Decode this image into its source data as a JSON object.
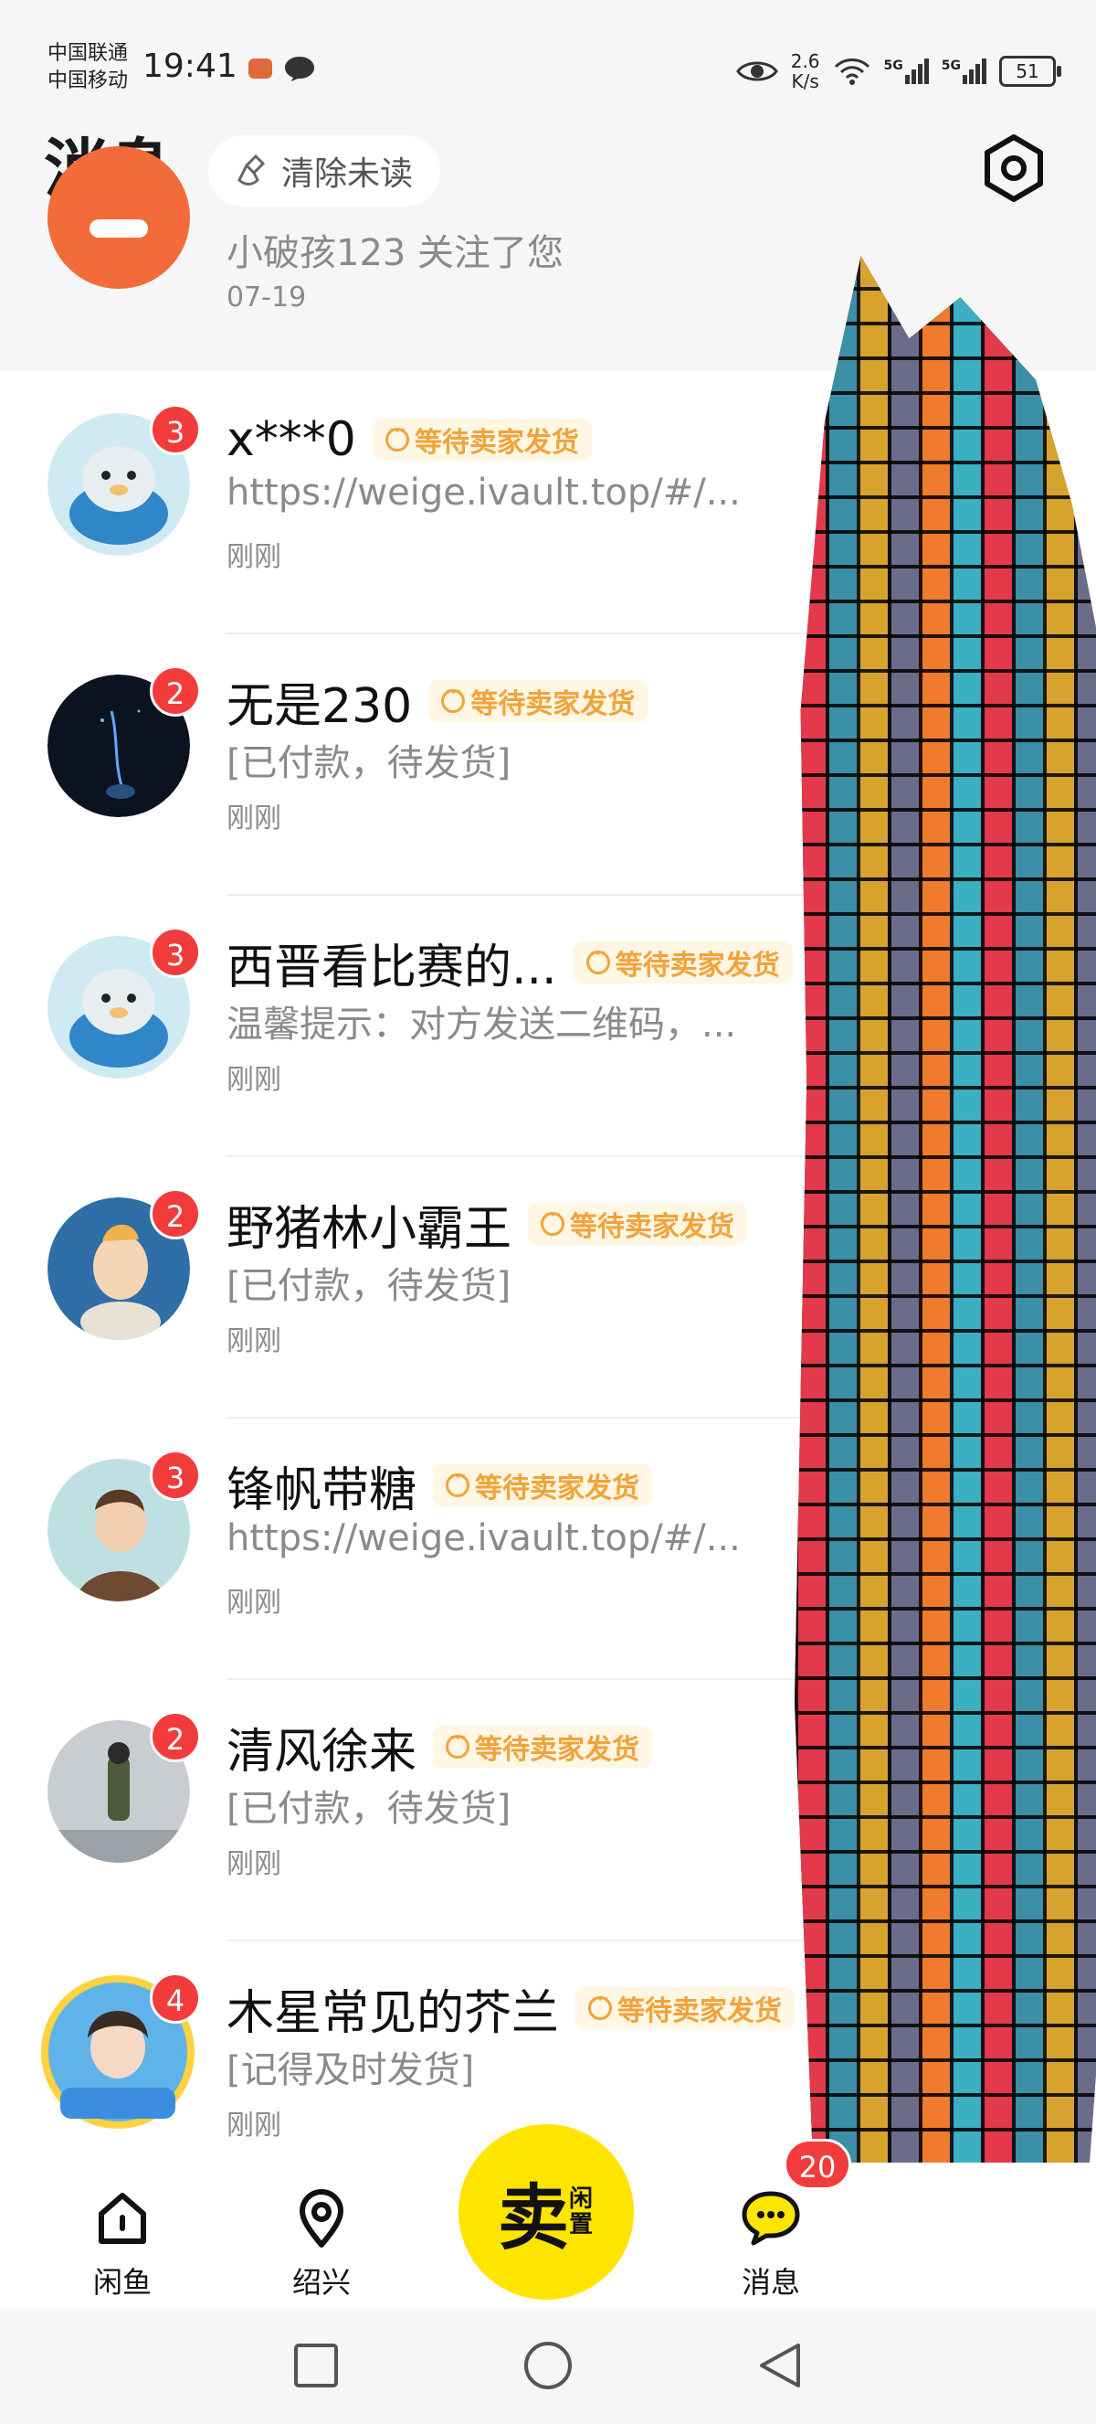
{
  "status": {
    "carrier1": "中国联通",
    "carrier2": "中国移动",
    "time": "19:41",
    "speed_value": "2.6",
    "speed_unit": "K/s",
    "signal1": "5G",
    "signal2": "5G",
    "battery": "51"
  },
  "header": {
    "title": "消息",
    "clear_label": "清除未读"
  },
  "partial_row": {
    "message": "小破孩123 关注了您",
    "time": "07-19"
  },
  "conversations": [
    {
      "name": "x***0",
      "badge": "3",
      "tag": "等待卖家发货",
      "preview": "https://weige.ivault.top/#/...",
      "time": "刚刚"
    },
    {
      "name": "无是230",
      "badge": "2",
      "tag": "等待卖家发货",
      "preview": "[已付款，待发货]",
      "time": "刚刚"
    },
    {
      "name": "西晋看比赛的...",
      "badge": "3",
      "tag": "等待卖家发货",
      "preview": "温馨提示：对方发送二维码，...",
      "time": "刚刚"
    },
    {
      "name": "野猪林小霸王",
      "badge": "2",
      "tag": "等待卖家发货",
      "preview": "[已付款，待发货]",
      "time": "刚刚"
    },
    {
      "name": "锋帆带糖",
      "badge": "3",
      "tag": "等待卖家发货",
      "preview": "https://weige.ivault.top/#/...",
      "time": "刚刚"
    },
    {
      "name": "清风徐来",
      "badge": "2",
      "tag": "等待卖家发货",
      "preview": "[已付款，待发货]",
      "time": "刚刚"
    },
    {
      "name": "木星常见的芥兰",
      "badge": "4",
      "tag": "等待卖家发货",
      "preview": "[记得及时发货]",
      "time": "刚刚"
    }
  ],
  "nav": {
    "home_label": "闲鱼",
    "local_label": "绍兴",
    "sell_main": "卖",
    "sell_sub": "闲置",
    "messages_label": "消息",
    "messages_badge": "20"
  },
  "colors": {
    "accent_yellow": "#ffe500",
    "badge_red": "#f23b3b",
    "tag_orange": "#f1a33a"
  }
}
